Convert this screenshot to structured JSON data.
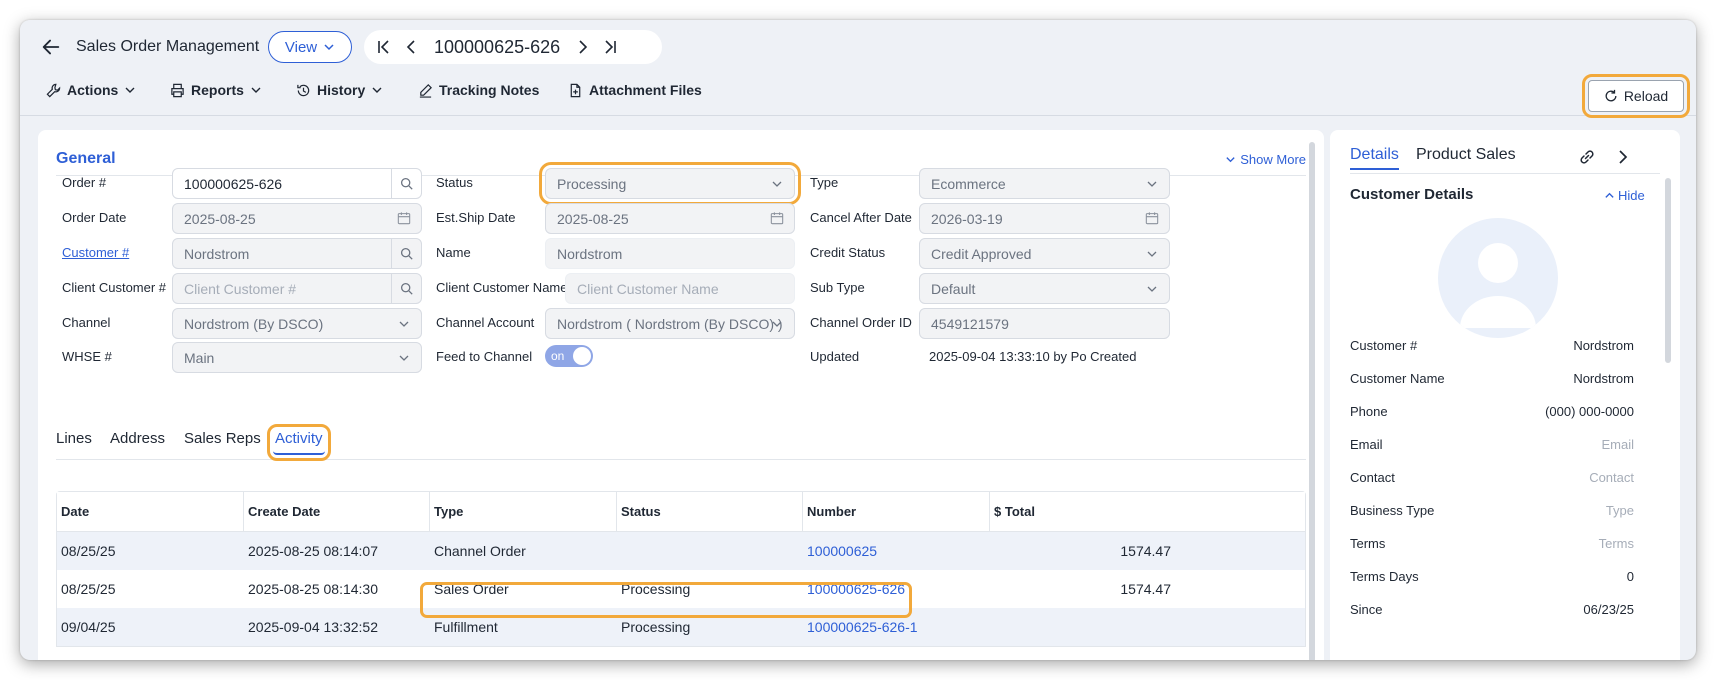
{
  "header": {
    "title": "Sales Order Management",
    "view_label": "View",
    "order_number": "100000625-626"
  },
  "toolbar": {
    "actions": "Actions",
    "reports": "Reports",
    "history": "History",
    "tracking_notes": "Tracking Notes",
    "attachment_files": "Attachment Files",
    "reload": "Reload"
  },
  "general": {
    "title": "General",
    "show_more": "Show More",
    "order_no_label": "Order #",
    "order_no": "100000625-626",
    "order_date_label": "Order Date",
    "order_date": "2025-08-25",
    "customer_label": "Customer #",
    "customer": "Nordstrom",
    "client_customer_label": "Client Customer #",
    "client_customer_ph": "Client Customer #",
    "channel_label": "Channel",
    "channel": "Nordstrom (By DSCO)",
    "whse_label": "WHSE #",
    "whse": "Main",
    "status_label": "Status",
    "status": "Processing",
    "est_ship_label": "Est.Ship Date",
    "est_ship": "2025-08-25",
    "name_label": "Name",
    "name": "Nordstrom",
    "client_customer_name_label": "Client Customer Name",
    "client_customer_name_ph": "Client Customer Name",
    "channel_account_label": "Channel Account",
    "channel_account": "Nordstrom ( Nordstrom (By DSCO) )",
    "feed_label": "Feed to Channel",
    "feed_value": "on",
    "type_label": "Type",
    "type": "Ecommerce",
    "cancel_after_label": "Cancel After Date",
    "cancel_after": "2026-03-19",
    "credit_status_label": "Credit Status",
    "credit_status": "Credit Approved",
    "sub_type_label": "Sub Type",
    "sub_type": "Default",
    "channel_order_label": "Channel Order ID",
    "channel_order": "4549121579",
    "updated_label": "Updated",
    "updated": "2025-09-04 13:33:10 by Po Created"
  },
  "tabs": [
    "Lines",
    "Address",
    "Sales Reps",
    "Activity"
  ],
  "activity": {
    "headers": [
      "Date",
      "Create Date",
      "Type",
      "Status",
      "Number",
      "$ Total"
    ],
    "rows": [
      {
        "date": "08/25/25",
        "create": "2025-08-25 08:14:07",
        "type": "Channel Order",
        "status": "",
        "number": "100000625",
        "total": "1574.47"
      },
      {
        "date": "08/25/25",
        "create": "2025-08-25 08:14:30",
        "type": "Sales Order",
        "status": "Processing",
        "number": "100000625-626",
        "total": "1574.47"
      },
      {
        "date": "09/04/25",
        "create": "2025-09-04 13:32:52",
        "type": "Fulfillment",
        "status": "Processing",
        "number": "100000625-626-1",
        "total": ""
      }
    ]
  },
  "side": {
    "tab_details": "Details",
    "tab_product_sales": "Product Sales",
    "customer_details": "Customer Details",
    "hide": "Hide",
    "fields": [
      {
        "label": "Customer #",
        "value": "Nordstrom",
        "placeholder": false
      },
      {
        "label": "Customer Name",
        "value": "Nordstrom",
        "placeholder": false
      },
      {
        "label": "Phone",
        "value": "(000) 000-0000",
        "placeholder": false
      },
      {
        "label": "Email",
        "value": "Email",
        "placeholder": true
      },
      {
        "label": "Contact",
        "value": "Contact",
        "placeholder": true
      },
      {
        "label": "Business Type",
        "value": "Type",
        "placeholder": true
      },
      {
        "label": "Terms",
        "value": "Terms",
        "placeholder": true
      },
      {
        "label": "Terms Days",
        "value": "0",
        "placeholder": false
      },
      {
        "label": "Since",
        "value": "06/23/25",
        "placeholder": false
      }
    ]
  },
  "colors": {
    "accent": "#2e5fd6",
    "highlight": "#f2a93b"
  }
}
